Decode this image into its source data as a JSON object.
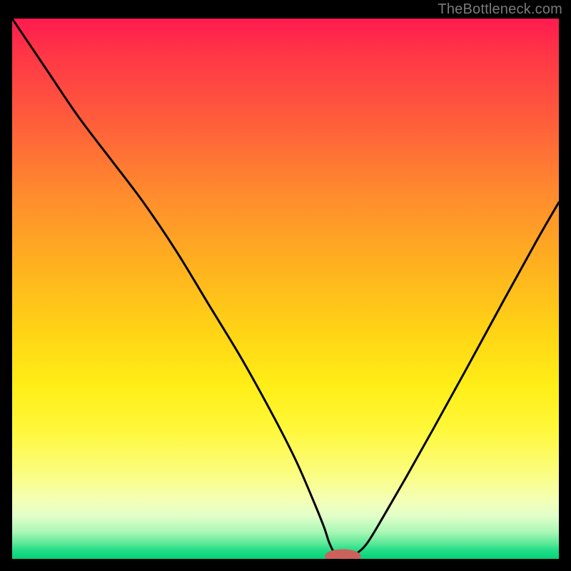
{
  "watermark": "TheBottleneck.com",
  "chart_data": {
    "type": "line",
    "title": "",
    "xlabel": "",
    "ylabel": "",
    "xlim": [
      0,
      100
    ],
    "ylim": [
      0,
      100
    ],
    "series": [
      {
        "name": "curve",
        "x": [
          0,
          6,
          12,
          18,
          24,
          30,
          36,
          42,
          48,
          52,
          55,
          57,
          58,
          59,
          60,
          61,
          63,
          65,
          68,
          72,
          77,
          83,
          90,
          96,
          100
        ],
        "y": [
          100,
          91,
          82,
          74,
          66,
          57,
          47,
          37,
          26,
          18,
          11,
          6,
          3,
          1,
          0,
          0,
          1,
          3,
          8,
          15,
          24,
          35,
          48,
          59,
          66
        ]
      }
    ],
    "marker": {
      "x": 60.5,
      "y": 0.5,
      "rx": 3.3,
      "ry": 1.3,
      "color": "#cc615b"
    },
    "gradient_stops": [
      {
        "pos": 0.0,
        "color": "#ff1a4f"
      },
      {
        "pos": 0.5,
        "color": "#ffd415"
      },
      {
        "pos": 0.85,
        "color": "#fbfd7e"
      },
      {
        "pos": 1.0,
        "color": "#06d178"
      }
    ]
  }
}
